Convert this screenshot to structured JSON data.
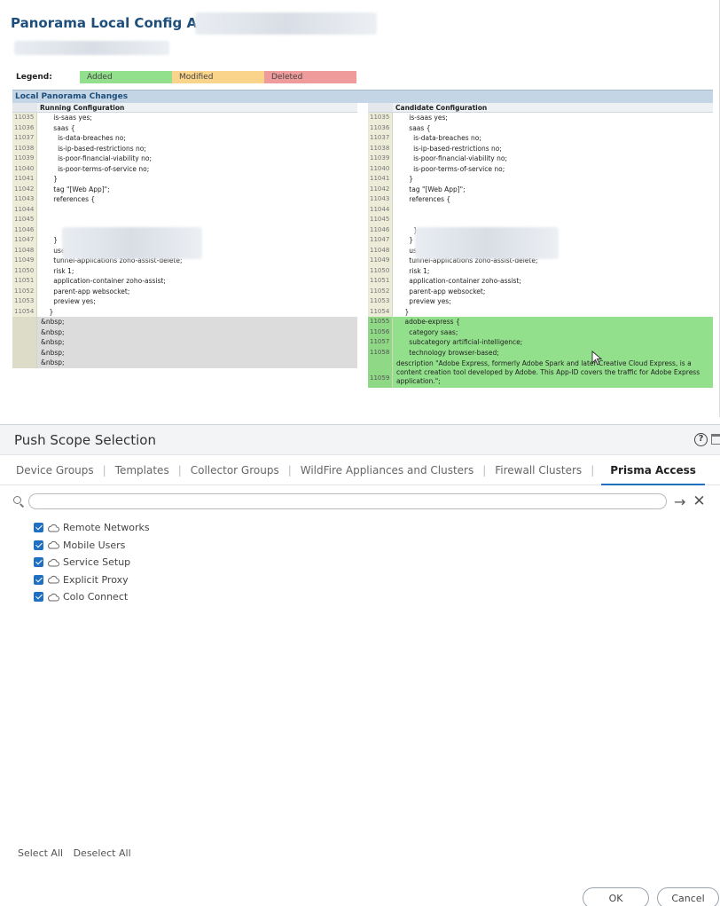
{
  "audit": {
    "title": "Panorama Local Config Audit",
    "legend": {
      "label": "Legend:",
      "added": "Added",
      "modified": "Modified",
      "deleted": "Deleted"
    },
    "section_header": "Local Panorama Changes",
    "running_title": "Running Configuration",
    "candidate_title": "Candidate Configuration",
    "running_rows": [
      {
        "n": "11035",
        "t": "      is-saas yes;",
        "k": "normal"
      },
      {
        "n": "11036",
        "t": "      saas {",
        "k": "normal"
      },
      {
        "n": "11037",
        "t": "        is-data-breaches no;",
        "k": "normal"
      },
      {
        "n": "11038",
        "t": "        is-ip-based-restrictions no;",
        "k": "normal"
      },
      {
        "n": "11039",
        "t": "        is-poor-financial-viability no;",
        "k": "normal"
      },
      {
        "n": "11040",
        "t": "        is-poor-terms-of-service no;",
        "k": "normal"
      },
      {
        "n": "11041",
        "t": "      }",
        "k": "normal"
      },
      {
        "n": "11042",
        "t": "      tag \"[Web App]\";",
        "k": "normal"
      },
      {
        "n": "11043",
        "t": "      references {",
        "k": "normal"
      },
      {
        "n": "11044",
        "t": "",
        "k": "normal"
      },
      {
        "n": "11045",
        "t": "",
        "k": "normal"
      },
      {
        "n": "11046",
        "t": "",
        "k": "normal"
      },
      {
        "n": "11047",
        "t": "      }",
        "k": "normal"
      },
      {
        "n": "11048",
        "t": "      use-applications [ ssl web-browsing];",
        "k": "normal"
      },
      {
        "n": "11049",
        "t": "      tunnel-applications zoho-assist-delete;",
        "k": "normal"
      },
      {
        "n": "11050",
        "t": "      risk 1;",
        "k": "normal"
      },
      {
        "n": "11051",
        "t": "      application-container zoho-assist;",
        "k": "normal"
      },
      {
        "n": "11052",
        "t": "      parent-app websocket;",
        "k": "normal"
      },
      {
        "n": "11053",
        "t": "      preview yes;",
        "k": "normal"
      },
      {
        "n": "11054",
        "t": "    }",
        "k": "normal"
      },
      {
        "n": "",
        "t": "&nbsp;",
        "k": "empty"
      },
      {
        "n": "",
        "t": "&nbsp;",
        "k": "empty"
      },
      {
        "n": "",
        "t": "&nbsp;",
        "k": "empty"
      },
      {
        "n": "",
        "t": "&nbsp;",
        "k": "empty"
      },
      {
        "n": "",
        "t": "&nbsp;",
        "k": "empty"
      }
    ],
    "candidate_rows": [
      {
        "n": "11035",
        "t": "      is-saas yes;",
        "k": "normal"
      },
      {
        "n": "11036",
        "t": "      saas {",
        "k": "normal"
      },
      {
        "n": "11037",
        "t": "        is-data-breaches no;",
        "k": "normal"
      },
      {
        "n": "11038",
        "t": "        is-ip-based-restrictions no;",
        "k": "normal"
      },
      {
        "n": "11039",
        "t": "        is-poor-financial-viability no;",
        "k": "normal"
      },
      {
        "n": "11040",
        "t": "        is-poor-terms-of-service no;",
        "k": "normal"
      },
      {
        "n": "11041",
        "t": "      }",
        "k": "normal"
      },
      {
        "n": "11042",
        "t": "      tag \"[Web App]\";",
        "k": "normal"
      },
      {
        "n": "11043",
        "t": "      references {",
        "k": "normal"
      },
      {
        "n": "11044",
        "t": "",
        "k": "normal"
      },
      {
        "n": "11045",
        "t": "",
        "k": "normal"
      },
      {
        "n": "11046",
        "t": "        }",
        "k": "normal"
      },
      {
        "n": "11047",
        "t": "      }",
        "k": "normal"
      },
      {
        "n": "11048",
        "t": "      use-applications [ ssl web-browsing];",
        "k": "normal"
      },
      {
        "n": "11049",
        "t": "      tunnel-applications zoho-assist-delete;",
        "k": "normal"
      },
      {
        "n": "11050",
        "t": "      risk 1;",
        "k": "normal"
      },
      {
        "n": "11051",
        "t": "      application-container zoho-assist;",
        "k": "normal"
      },
      {
        "n": "11052",
        "t": "      parent-app websocket;",
        "k": "normal"
      },
      {
        "n": "11053",
        "t": "      preview yes;",
        "k": "normal"
      },
      {
        "n": "11054",
        "t": "    }",
        "k": "normal"
      },
      {
        "n": "11055",
        "t": "    adobe-express {",
        "k": "added"
      },
      {
        "n": "11056",
        "t": "      category saas;",
        "k": "added"
      },
      {
        "n": "11057",
        "t": "      subcategory artificial-intelligence;",
        "k": "added"
      },
      {
        "n": "11058",
        "t": "      technology browser-based;",
        "k": "added"
      },
      {
        "n": "11059",
        "t": "      description \"Adobe Express, formerly Adobe Spark and later Creative Cloud Express, is a content creation tool developed by Adobe. This App-ID covers the traffic for Adobe Express application.\";",
        "k": "added-tall"
      }
    ]
  },
  "scope": {
    "title": "Push Scope Selection",
    "help_icon": "?",
    "tabs": [
      {
        "label": "Device Groups"
      },
      {
        "label": "Templates"
      },
      {
        "label": "Collector Groups"
      },
      {
        "label": "WildFire Appliances and Clusters"
      },
      {
        "label": "Firewall Clusters"
      },
      {
        "label": "Prisma Access"
      }
    ],
    "active_tab": "Prisma Access",
    "search_placeholder": "",
    "items": [
      {
        "label": "Remote Networks"
      },
      {
        "label": "Mobile Users"
      },
      {
        "label": "Service Setup"
      },
      {
        "label": "Explicit Proxy"
      },
      {
        "label": "Colo Connect"
      }
    ],
    "select_all": "Select All",
    "deselect_all": "Deselect All",
    "ok": "OK",
    "cancel": "Cancel"
  },
  "colors": {
    "added": "#93e08c",
    "modified": "#fad48a",
    "deleted": "#ef9b9b",
    "accent": "#1f70c1",
    "title": "#1d4e7c"
  },
  "icons": [
    "search-icon",
    "arrow-right-icon",
    "close-icon",
    "help-icon",
    "cloud-icon",
    "checkbox-checked-icon",
    "mouse-cursor-icon"
  ]
}
